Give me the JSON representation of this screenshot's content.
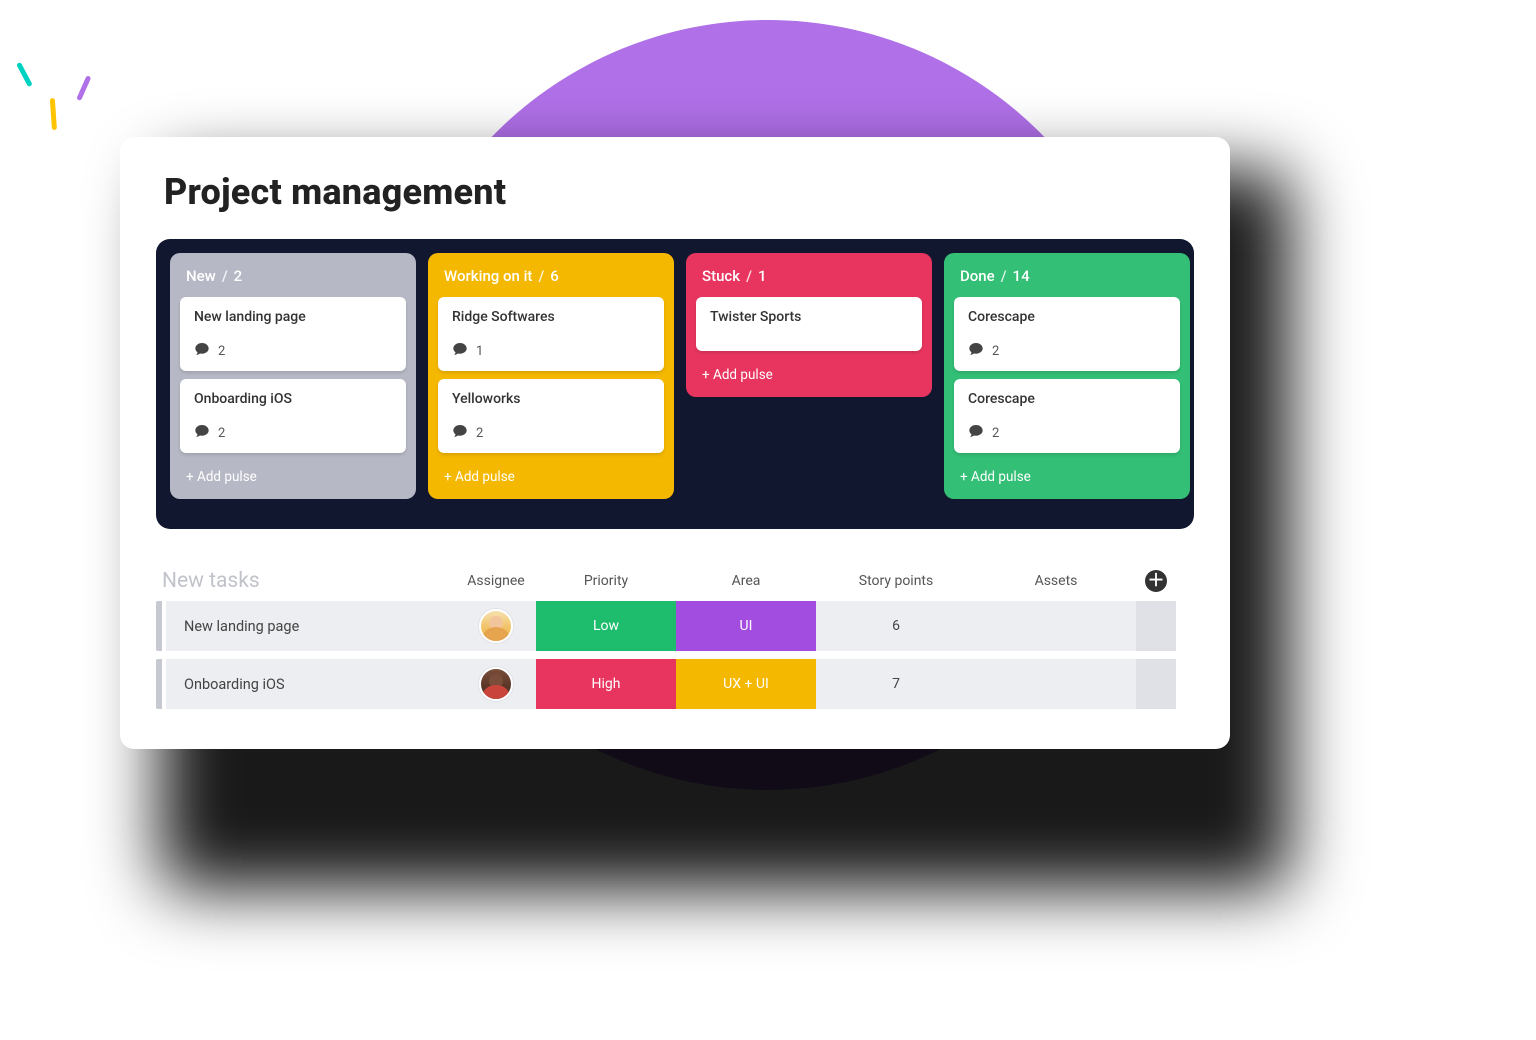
{
  "title": "Project management",
  "add_pulse_label": "+ Add pulse",
  "board": {
    "columns": [
      {
        "id": "new",
        "name": "New",
        "count": 2,
        "color": "grey",
        "cards": [
          {
            "title": "New landing page",
            "comments": 2
          },
          {
            "title": "Onboarding iOS",
            "comments": 2
          }
        ],
        "show_add": true
      },
      {
        "id": "working",
        "name": "Working on it",
        "count": 6,
        "color": "yellow",
        "cards": [
          {
            "title": "Ridge Softwares",
            "comments": 1
          },
          {
            "title": "Yelloworks",
            "comments": 2
          }
        ],
        "show_add": true
      },
      {
        "id": "stuck",
        "name": "Stuck",
        "count": 1,
        "color": "pink",
        "cards": [
          {
            "title": "Twister Sports"
          }
        ],
        "show_add": true
      },
      {
        "id": "done",
        "name": "Done",
        "count": 14,
        "color": "green",
        "cards": [
          {
            "title": "Corescape",
            "comments": 2
          },
          {
            "title": "Corescape",
            "comments": 2
          }
        ],
        "show_add": true
      }
    ]
  },
  "tasks": {
    "section_title": "New tasks",
    "headers": {
      "assignee": "Assignee",
      "priority": "Priority",
      "area": "Area",
      "points": "Story points",
      "assets": "Assets"
    },
    "rows": [
      {
        "name": "New landing page",
        "avatar": "f",
        "priority": "Low",
        "priority_class": "pri-low",
        "area": "UI",
        "area_class": "area-ui",
        "points": 6
      },
      {
        "name": "Onboarding iOS",
        "avatar": "m",
        "priority": "High",
        "priority_class": "pri-high",
        "area": "UX + UI",
        "area_class": "area-ux",
        "points": 7
      }
    ]
  }
}
